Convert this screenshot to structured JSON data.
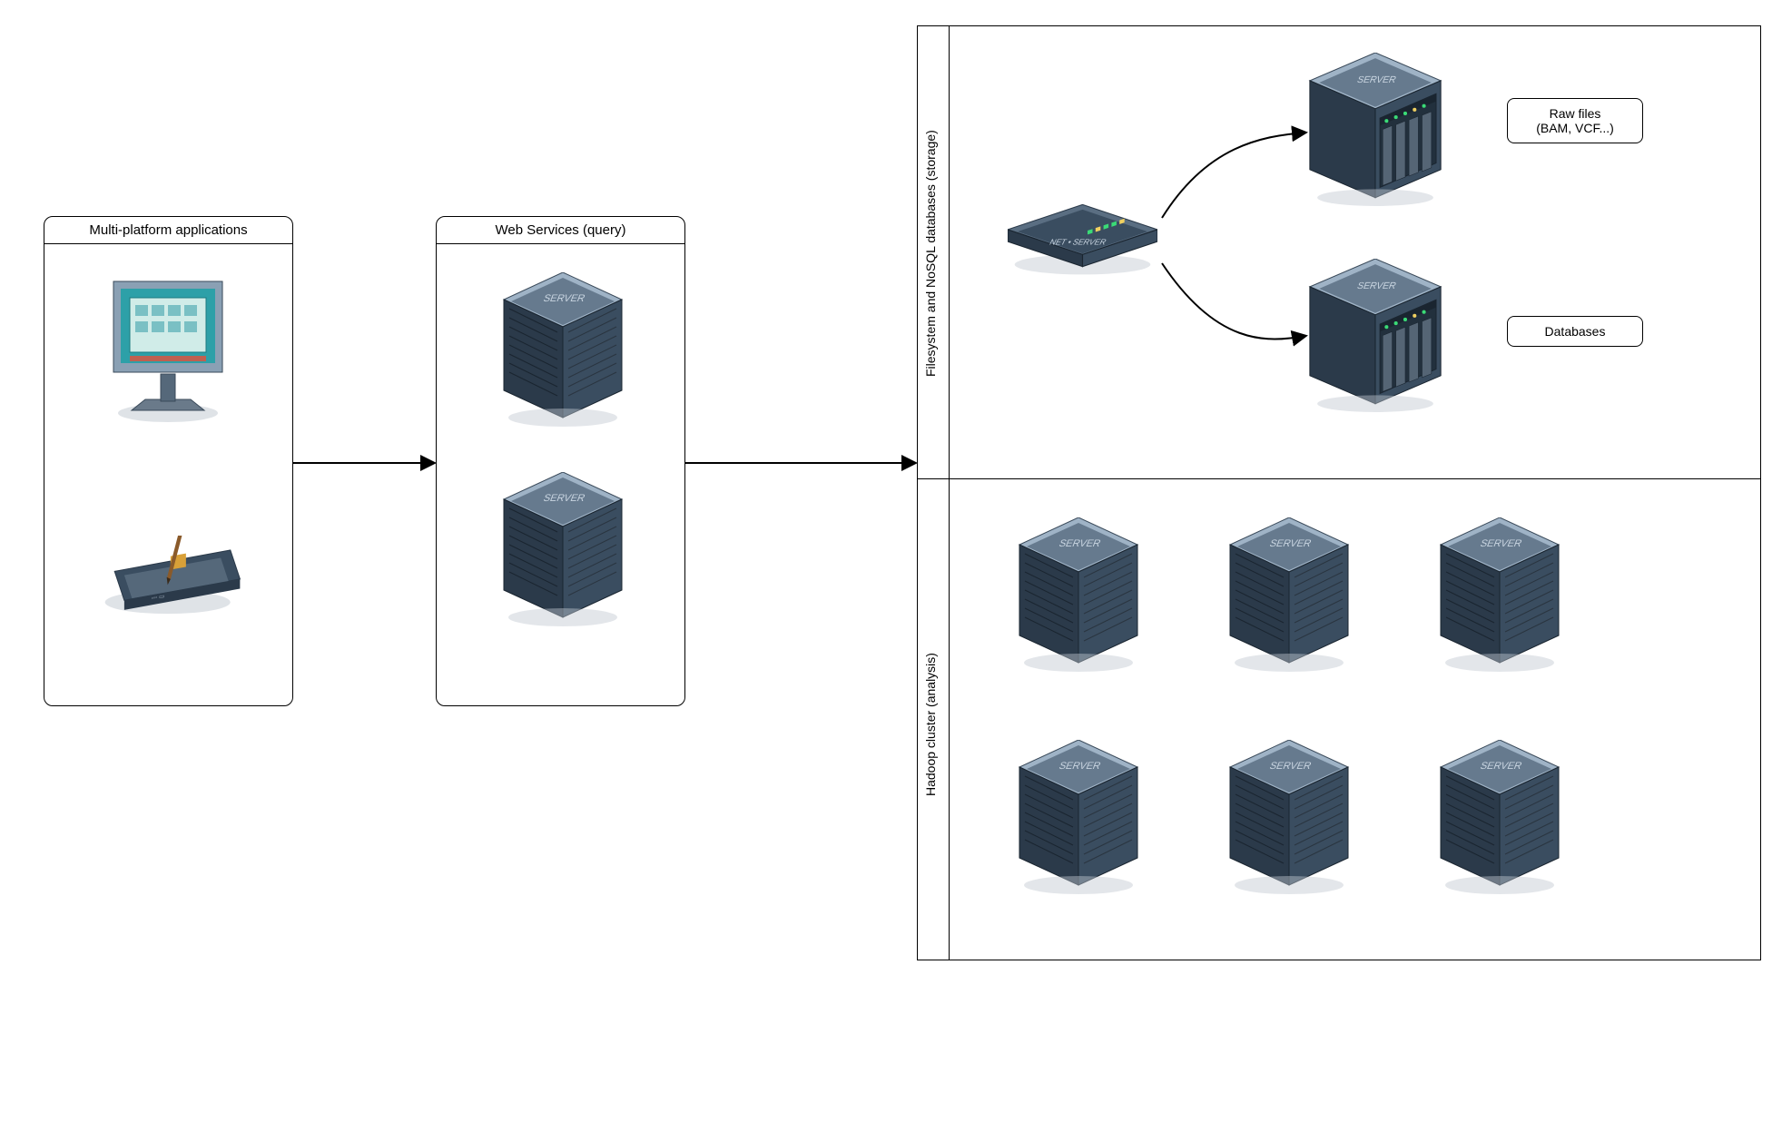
{
  "diagram": {
    "groups": {
      "clients": {
        "title": "Multi-platform applications"
      },
      "webservices": {
        "title": "Web Services (query)"
      },
      "storage": {
        "title": "Filesystem and NoSQL databases (storage)"
      },
      "hadoop": {
        "title": "Hadoop cluster (analysis)"
      }
    },
    "callouts": {
      "raw_files": "Raw files\n(BAM, VCF...)",
      "databases": "Databases"
    },
    "icons": {
      "desktop": "desktop-computer-icon",
      "tablet": "tablet-stylus-icon",
      "server": "server-tower-icon",
      "router": "network-router-icon",
      "storage_server": "storage-server-icon"
    },
    "server_label": "SERVER",
    "flows": [
      {
        "from": "clients",
        "to": "webservices"
      },
      {
        "from": "webservices",
        "to": "storage_hadoop"
      },
      {
        "from": "router",
        "to": "storage:raw_files"
      },
      {
        "from": "router",
        "to": "storage:databases"
      }
    ],
    "colors": {
      "border": "#000000",
      "server_dark": "#2b3a4a",
      "server_light": "#8aa0b4",
      "screen_teal": "#2da0a8"
    }
  }
}
